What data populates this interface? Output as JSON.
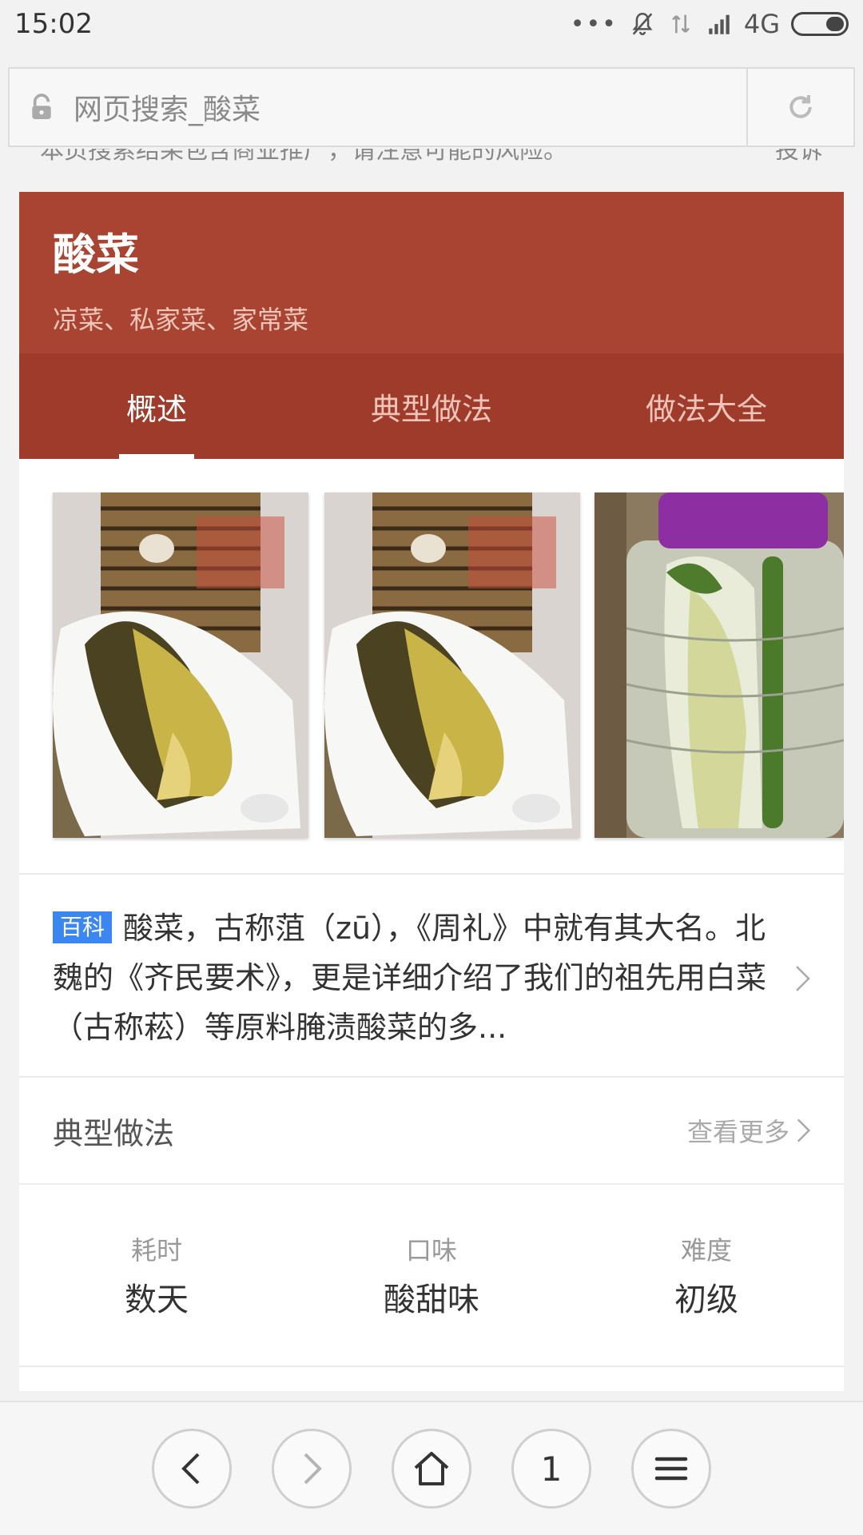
{
  "status_bar": {
    "time": "15:02",
    "network": "4G",
    "icons": [
      "more-dots-icon",
      "mute-icon",
      "data-transfer-icon",
      "signal-icon",
      "battery-icon"
    ]
  },
  "address_bar": {
    "text": "网页搜索_酸菜",
    "icons": [
      "lock-icon",
      "refresh-icon"
    ]
  },
  "notice": {
    "text": "本页搜索结果包含商业推广，请注意可能的风险。",
    "report": "投诉"
  },
  "card": {
    "title": "酸菜",
    "subtitle": "凉菜、私家菜、家常菜",
    "tabs": [
      {
        "label": "概述",
        "active": true
      },
      {
        "label": "典型做法",
        "active": false
      },
      {
        "label": "做法大全",
        "active": false
      }
    ],
    "images": [
      {
        "name": "pickled-cabbage-plate-photo"
      },
      {
        "name": "pickled-cabbage-plate-photo"
      },
      {
        "name": "pickled-cabbage-jar-photo"
      }
    ],
    "baike": {
      "badge": "百科",
      "text": "酸菜，古称菹（zū），《周礼》中就有其大名。北魏的《齐民要术》，更是详细介绍了我们的祖先用白菜（古称菘）等原料腌渍酸菜的多..."
    },
    "typical": {
      "title": "典型做法",
      "more": "查看更多"
    },
    "info": [
      {
        "label": "耗时",
        "value": "数天"
      },
      {
        "label": "口味",
        "value": "酸甜味"
      },
      {
        "label": "难度",
        "value": "初级"
      }
    ]
  },
  "bottom_nav": {
    "tab_count": "1",
    "buttons": [
      "back-icon",
      "forward-icon",
      "home-icon",
      "tabs-counter",
      "menu-icon"
    ]
  },
  "colors": {
    "header_red": "#a84431",
    "tab_red": "#9e3b2b",
    "badge_blue": "#3b86f0"
  }
}
